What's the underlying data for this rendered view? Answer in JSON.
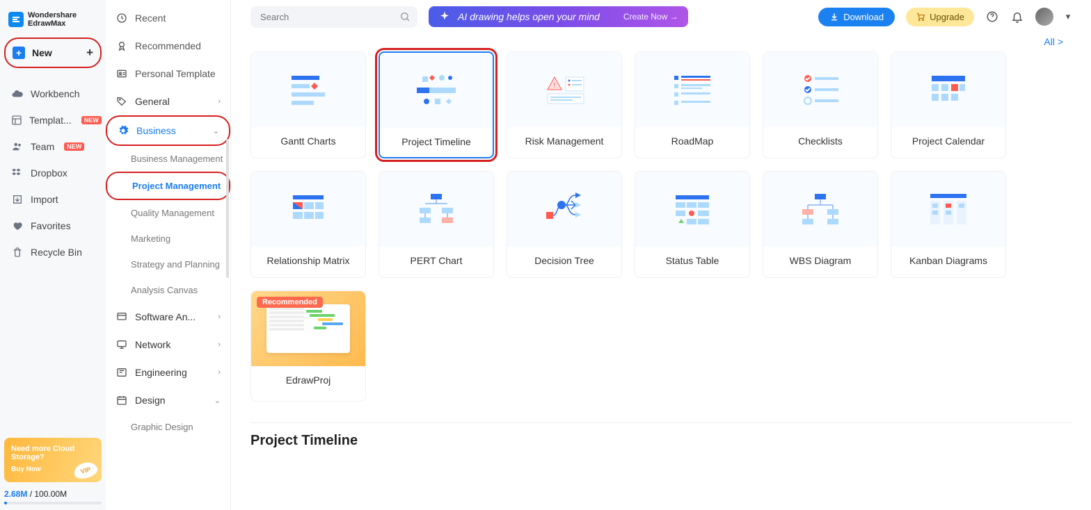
{
  "app": {
    "brand1": "Wondershare",
    "brand2": "EdrawMax"
  },
  "leftNav": {
    "new": "New",
    "workbench": "Workbench",
    "templates": "Templat...",
    "team": "Team",
    "dropbox": "Dropbox",
    "import": "Import",
    "favorites": "Favorites",
    "recycle": "Recycle Bin",
    "badgeNew": "NEW"
  },
  "promo": {
    "title": "Need more Cloud Storage?",
    "buy": "Buy Now",
    "chip": "VIP"
  },
  "storage": {
    "used": "2.68M",
    "total": " / 100.00M"
  },
  "categories": {
    "recent": "Recent",
    "recommended": "Recommended",
    "personal": "Personal Template",
    "general": "General",
    "business": "Business",
    "business_subs": [
      "Business Management",
      "Project Management",
      "Quality Management",
      "Marketing",
      "Strategy and Planning",
      "Analysis Canvas"
    ],
    "software": "Software An...",
    "network": "Network",
    "engineering": "Engineering",
    "design": "Design",
    "graphic": "Graphic Design"
  },
  "topbar": {
    "searchPlaceholder": "Search",
    "aiBanner": "AI drawing helps open your mind",
    "createNow": "Create Now",
    "download": "Download",
    "upgrade": "Upgrade"
  },
  "allLink": "All  >",
  "templates": [
    "Gantt Charts",
    "Project Timeline",
    "Risk Management",
    "RoadMap",
    "Checklists",
    "Project Calendar",
    "Relationship Matrix",
    "PERT Chart",
    "Decision Tree",
    "Status Table",
    "WBS Diagram",
    "Kanban Diagrams"
  ],
  "recommendedLabel": "Recommended",
  "edrawProj": "EdrawProj",
  "sectionTitle": "Project Timeline"
}
